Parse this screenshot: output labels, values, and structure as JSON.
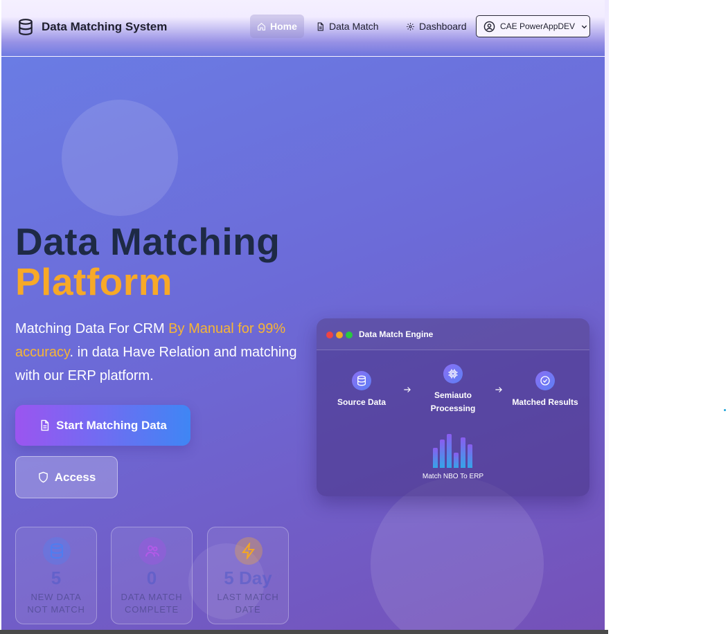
{
  "navbar": {
    "brand": "Data Matching System",
    "items": [
      {
        "label": "Home",
        "icon": "home-icon",
        "active": true
      },
      {
        "label": "Data Match",
        "icon": "document-icon"
      },
      {
        "label": "Dashboard",
        "icon": "gear-icon"
      }
    ],
    "user": {
      "label": "CAE PowerAppDEV",
      "icon": "user-circle-icon"
    }
  },
  "hero": {
    "title_line1": "Data Matching",
    "title_line2": "Platform",
    "desc_part1": "Matching Data For CRM ",
    "desc_highlight": "By Manual for 99% accuracy",
    "desc_part2": ". in data Have Relation and matching with our ERP platform.",
    "start_button": "Start Matching Data",
    "access_button": "Access"
  },
  "stats": [
    {
      "value": "5",
      "label_line1": "NEW DATA",
      "label_line2": "NOT MATCH",
      "icon": "database-icon"
    },
    {
      "value": "0",
      "label_line1": "DATA MATCH",
      "label_line2": "COMPLETE",
      "icon": "users-icon"
    },
    {
      "value": "5 Day",
      "label_line1": "LAST MATCH",
      "label_line2": "DATE",
      "icon": "lightning-icon"
    }
  ],
  "engine": {
    "title": "Data Match Engine",
    "steps": [
      {
        "line1": "Source Data",
        "line2": "",
        "icon": "database-icon"
      },
      {
        "line1": "Semiauto",
        "line2": "Processing",
        "icon": "chip-icon"
      },
      {
        "line1": "Matched Results",
        "line2": "",
        "icon": "check-circle-icon"
      }
    ],
    "bar_levels": [
      0.55,
      0.78,
      0.95,
      0.42,
      0.85,
      0.65
    ],
    "caption": "Match NBO To ERP"
  },
  "colors": {
    "accent": "#f7a928",
    "title_dark": "#1e2a45",
    "start_from": "#9b55f0",
    "start_to": "#3f86f4"
  }
}
